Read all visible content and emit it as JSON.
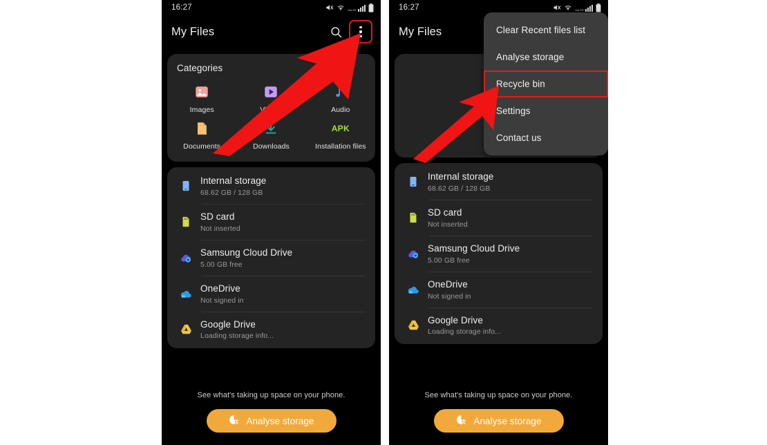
{
  "status_bar": {
    "time": "16:27",
    "icons": [
      "mute-icon",
      "wifi-icon",
      "volte-signal-icon",
      "battery-icon"
    ],
    "network_label": "VoLTE"
  },
  "app_bar": {
    "title": "My Files",
    "search_icon": "search-icon",
    "overflow_icon": "more-vertical-icon"
  },
  "categories": {
    "title": "Categories",
    "items": [
      {
        "label": "Images",
        "icon": "image-icon",
        "color": "#f08080"
      },
      {
        "label": "Videos",
        "icon": "video-icon",
        "color": "#c08cf0"
      },
      {
        "label": "Audio",
        "icon": "audio-note-icon",
        "color": "#4f7fe0"
      },
      {
        "label": "Documents",
        "icon": "document-icon",
        "color": "#f0bf6a"
      },
      {
        "label": "Downloads",
        "icon": "download-icon",
        "color": "#2fa6a6"
      },
      {
        "label": "Installation files",
        "icon": "apk-icon",
        "color": "#a8e02a"
      }
    ]
  },
  "storage": {
    "items": [
      {
        "name": "Internal storage",
        "sub": "68.62 GB / 128 GB",
        "icon": "phone-icon"
      },
      {
        "name": "SD card",
        "sub": "Not inserted",
        "icon": "sdcard-icon"
      },
      {
        "name": "Samsung Cloud Drive",
        "sub": "5.00 GB free",
        "icon": "samsung-cloud-icon"
      },
      {
        "name": "OneDrive",
        "sub": "Not signed in",
        "icon": "onedrive-icon"
      },
      {
        "name": "Google Drive",
        "sub": "Loading storage info...",
        "icon": "google-drive-icon"
      }
    ]
  },
  "footer": {
    "note": "See what's taking up space on your phone.",
    "button_label": "Analyse storage",
    "button_icon": "analyse-storage-icon",
    "button_color": "#f2a93b"
  },
  "overflow_menu": {
    "items": [
      {
        "label": "Clear Recent files list",
        "selected": false
      },
      {
        "label": "Analyse storage",
        "selected": false
      },
      {
        "label": "Recycle bin",
        "selected": true
      },
      {
        "label": "Settings",
        "selected": false
      },
      {
        "label": "Contact us",
        "selected": false
      }
    ]
  },
  "annotations": {
    "highlight_color": "#e01b1b",
    "arrow_color": "#f01414",
    "arrow_left_target": "more-vertical-icon",
    "arrow_right_target": "menu-item-recycle-bin"
  }
}
